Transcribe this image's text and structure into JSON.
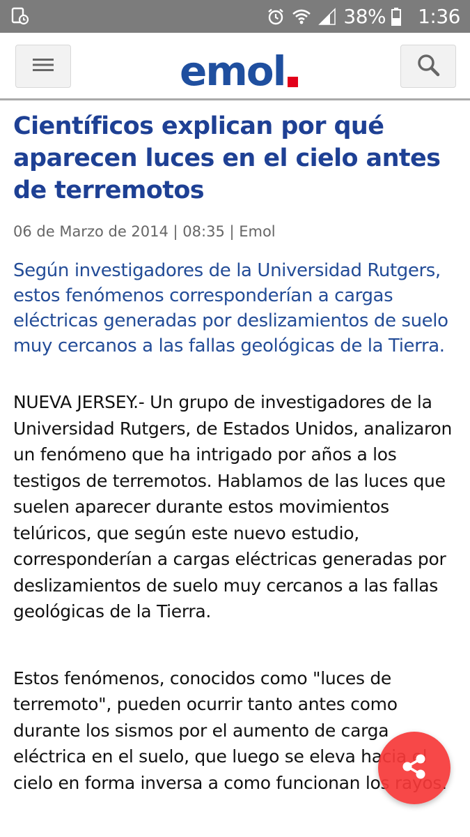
{
  "status_bar": {
    "battery_percent": "38%",
    "time": "1:36",
    "icons": [
      "screenshot-notification-icon",
      "alarm-icon",
      "wifi-icon",
      "signal-icon",
      "battery-icon"
    ]
  },
  "header": {
    "logo_text": "emol",
    "logo_dot_color": "#e2001a",
    "logo_color": "#1f4f9f",
    "menu_icon": "hamburger-menu-icon",
    "search_icon": "search-icon"
  },
  "article": {
    "headline": "Científicos explican por qué aparecen luces en el cielo antes de terremotos",
    "meta": "06 de Marzo de 2014 | 08:35 | Emol",
    "lead": "Según investigadores de la Universidad Rutgers, estos fenómenos corresponderían a cargas eléctricas generadas por deslizamientos de suelo muy cercanos a las fallas geológicas de la Tierra.",
    "paragraphs": [
      "NUEVA JERSEY.- Un grupo de investigadores de la Universidad Rutgers, de Estados Unidos, analizaron un fenómeno que ha intrigado por años a los testigos de terremotos. Hablamos de las luces que suelen aparecer durante estos movimientos telúricos, que según este nuevo estudio, corresponderían a cargas eléctricas generadas por deslizamientos de suelo muy cercanos a las fallas geológicas de la Tierra.",
      "Estos fenómenos, conocidos como \"luces de terremoto\", pueden ocurrir tanto antes como durante los sismos por el aumento de carga eléctrica en el suelo, que luego se eleva hacia el cielo en forma inversa a como funcionan los rayos."
    ]
  },
  "share_button": {
    "icon": "share-icon",
    "color": "#f63838"
  }
}
